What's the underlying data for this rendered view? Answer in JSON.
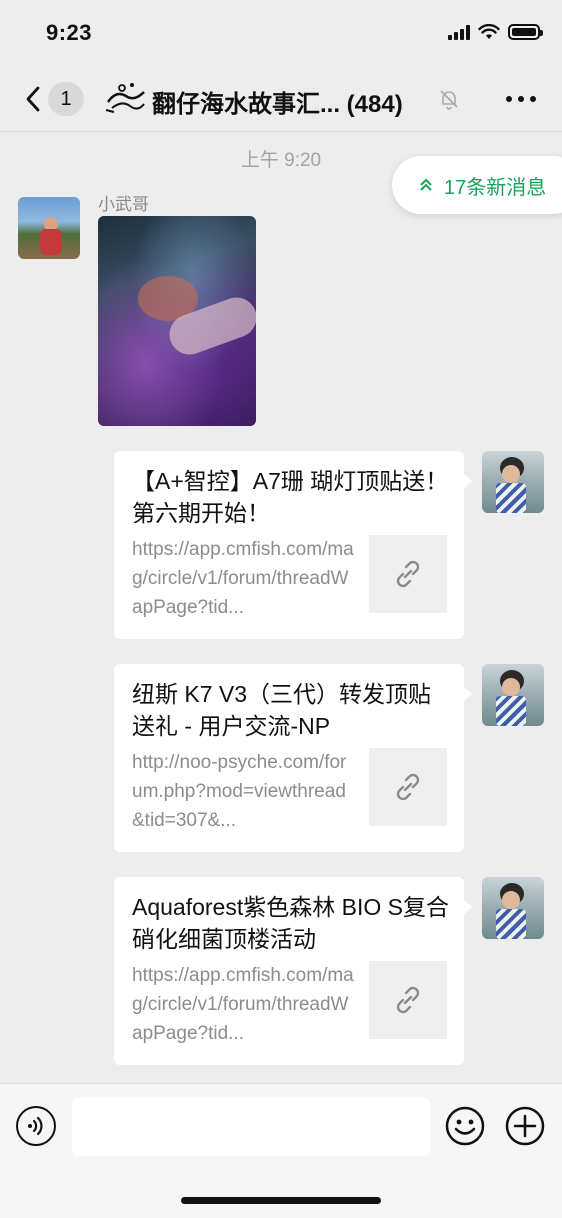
{
  "status_bar": {
    "time": "9:23"
  },
  "nav": {
    "unread_count": "1",
    "title": "翻仔海水故事汇...  (484)"
  },
  "chat": {
    "timestamp": "上午 9:20",
    "new_messages_pill": "17条新消息",
    "messages": [
      {
        "type": "image",
        "sender": "小武哥"
      },
      {
        "type": "link",
        "title": "【A+智控】A7珊 瑚灯顶贴送！第六期开始！",
        "url": "https://app.cmfish.com/mag/circle/v1/forum/threadWapPage?tid..."
      },
      {
        "type": "link",
        "title": "纽斯 K7 V3（三代）转发顶贴送礼 - 用户交流-NP",
        "url": "http://noo-psyche.com/forum.php?mod=viewthread&tid=307&..."
      },
      {
        "type": "link",
        "title": "Aquaforest紫色森林 BIO S复合硝化细菌顶楼活动",
        "url": "https://app.cmfish.com/mag/circle/v1/forum/threadWapPage?tid..."
      }
    ]
  },
  "input_bar": {
    "text_value": ""
  },
  "colors": {
    "background": "#ededed",
    "accent_green": "#15a35a",
    "bubble": "#ffffff",
    "secondary_text": "#8c8c8c"
  },
  "icons": [
    "back-chevron-icon",
    "group-logo-icon",
    "mute-bell-icon",
    "more-icon",
    "double-chevron-up-icon",
    "link-icon",
    "voice-icon",
    "emoji-icon",
    "plus-icon"
  ]
}
